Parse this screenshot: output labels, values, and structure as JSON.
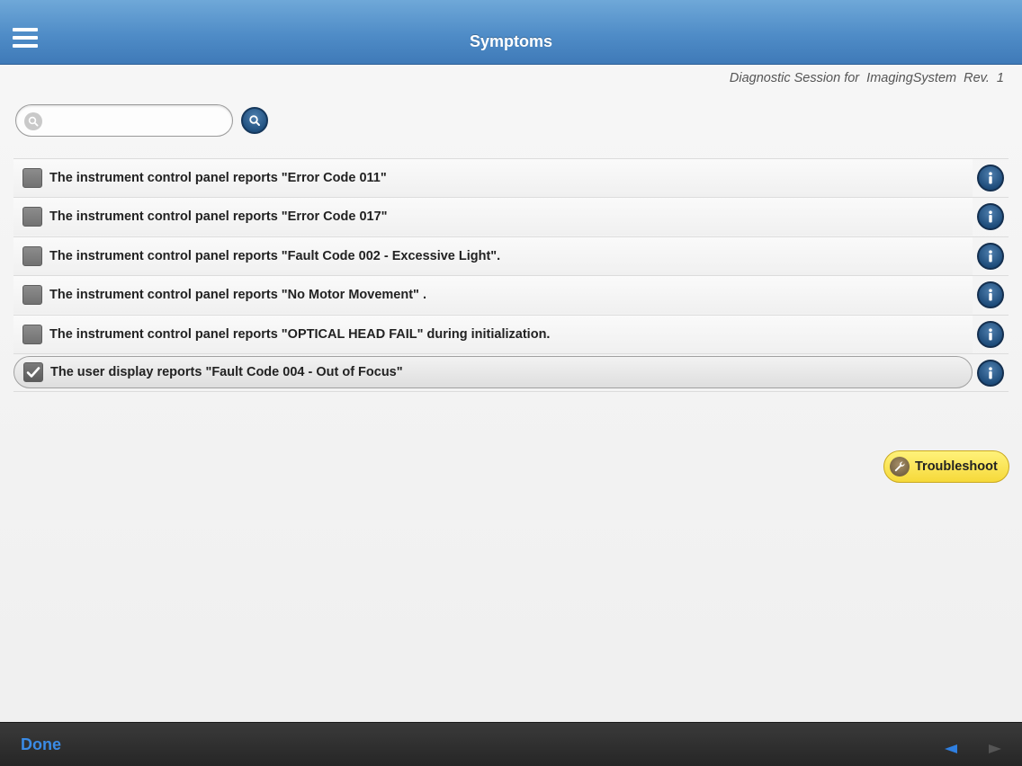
{
  "header": {
    "title": "Symptoms"
  },
  "session": {
    "prefix": "Diagnostic Session for",
    "system": "ImagingSystem",
    "rev": "Rev.",
    "rev_number": "1"
  },
  "search": {
    "value": "",
    "placeholder": ""
  },
  "symptoms": [
    {
      "label": "The instrument control panel reports \"Error Code 011\"",
      "checked": false
    },
    {
      "label": "The instrument control panel reports \"Error Code 017\"",
      "checked": false
    },
    {
      "label": "The instrument control panel reports \"Fault Code 002 - Excessive Light\".",
      "checked": false
    },
    {
      "label": "The instrument control panel reports \"No Motor Movement\" .",
      "checked": false
    },
    {
      "label": "The instrument control panel reports \"OPTICAL HEAD FAIL\" during initialization.",
      "checked": false
    },
    {
      "label": "The user display reports \"Fault Code 004 - Out of Focus\"",
      "checked": true
    }
  ],
  "actions": {
    "troubleshoot_label": "Troubleshoot"
  },
  "footer": {
    "done_label": "Done"
  },
  "colors": {
    "header": "#4f8cc7",
    "accent": "#3a8be6",
    "troubleshoot": "#f6d93a",
    "footer": "#2b2b2b"
  }
}
